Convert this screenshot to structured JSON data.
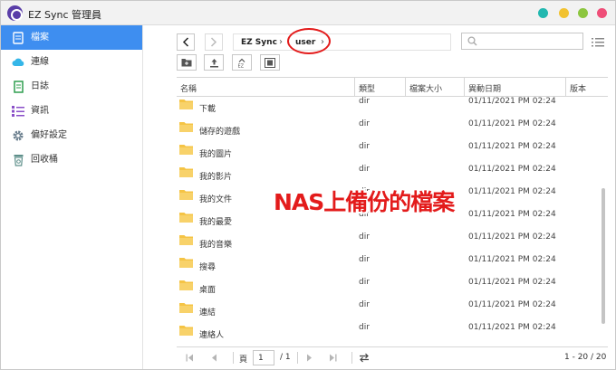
{
  "window": {
    "title": "EZ Sync 管理員"
  },
  "sidebar": {
    "items": [
      {
        "label": "檔案",
        "icon": "file-icon",
        "active": true
      },
      {
        "label": "連線",
        "icon": "cloud-icon",
        "active": false
      },
      {
        "label": "日誌",
        "icon": "log-icon",
        "active": false
      },
      {
        "label": "資訊",
        "icon": "info-list-icon",
        "active": false
      },
      {
        "label": "偏好設定",
        "icon": "gear-icon",
        "active": false
      },
      {
        "label": "回收桶",
        "icon": "recycle-bin-icon",
        "active": false
      }
    ]
  },
  "breadcrumb": {
    "items": [
      "EZ Sync",
      "user"
    ],
    "separator": "›"
  },
  "search": {
    "placeholder": ""
  },
  "table": {
    "columns": [
      "名稱",
      "類型",
      "檔案大小",
      "異動日期",
      "版本"
    ],
    "rows": [
      {
        "name": "下載",
        "type": "dir",
        "date": "01/11/2021 PM 02:24"
      },
      {
        "name": "儲存的遊戲",
        "type": "dir",
        "date": "01/11/2021 PM 02:24"
      },
      {
        "name": "我的圖片",
        "type": "dir",
        "date": "01/11/2021 PM 02:24"
      },
      {
        "name": "我的影片",
        "type": "dir",
        "date": "01/11/2021 PM 02:24"
      },
      {
        "name": "我的文件",
        "type": "dir",
        "date": "01/11/2021 PM 02:24"
      },
      {
        "name": "我的最愛",
        "type": "dir",
        "date": "01/11/2021 PM 02:24"
      },
      {
        "name": "我的音樂",
        "type": "dir",
        "date": "01/11/2021 PM 02:24"
      },
      {
        "name": "搜尋",
        "type": "dir",
        "date": "01/11/2021 PM 02:24"
      },
      {
        "name": "桌面",
        "type": "dir",
        "date": "01/11/2021 PM 02:24"
      },
      {
        "name": "連結",
        "type": "dir",
        "date": "01/11/2021 PM 02:24"
      },
      {
        "name": "連絡人",
        "type": "dir",
        "date": "01/11/2021 PM 02:24"
      }
    ]
  },
  "pager": {
    "page_label": "頁",
    "page_value": "1",
    "of_label": "/ 1",
    "range": "1 - 20 / 20"
  },
  "overlay": {
    "caption": "NAS上備份的檔案"
  },
  "colors": {
    "accent": "#3e8ef0",
    "annotation": "#e31b1b",
    "folder": "#f5c445"
  }
}
